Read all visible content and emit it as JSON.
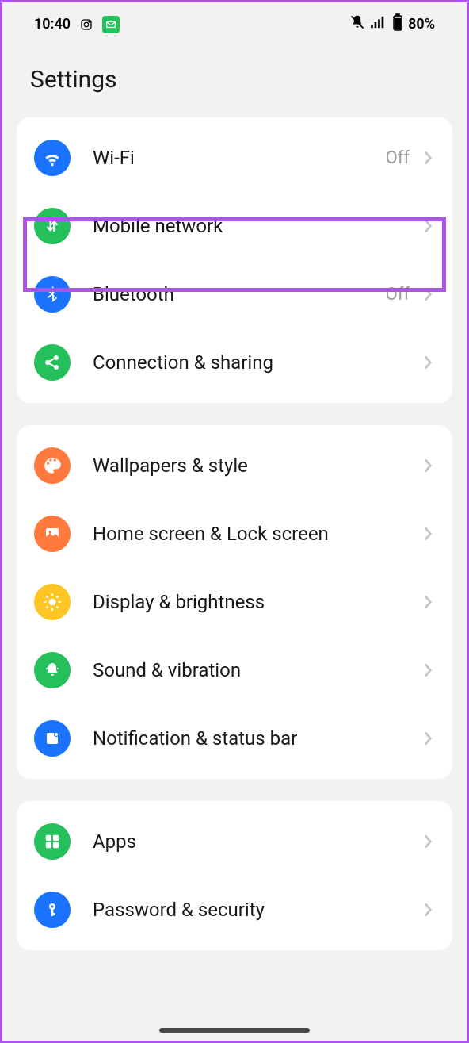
{
  "status": {
    "time": "10:40",
    "battery": "80%"
  },
  "header": {
    "title": "Settings"
  },
  "groups": [
    {
      "items": [
        {
          "key": "wifi",
          "label": "Wi-Fi",
          "status": "Off",
          "icon": "wifi",
          "color": "blue"
        },
        {
          "key": "mobile",
          "label": "Mobile network",
          "status": "",
          "icon": "data",
          "color": "green",
          "highlighted": true
        },
        {
          "key": "bluetooth",
          "label": "Bluetooth",
          "status": "Off",
          "icon": "bluetooth",
          "color": "blue"
        },
        {
          "key": "connection",
          "label": "Connection & sharing",
          "status": "",
          "icon": "share",
          "color": "green"
        }
      ]
    },
    {
      "items": [
        {
          "key": "wallpapers",
          "label": "Wallpapers & style",
          "status": "",
          "icon": "palette",
          "color": "orange"
        },
        {
          "key": "homescreen",
          "label": "Home screen & Lock screen",
          "status": "",
          "icon": "image",
          "color": "orange"
        },
        {
          "key": "display",
          "label": "Display & brightness",
          "status": "",
          "icon": "sun",
          "color": "yellow"
        },
        {
          "key": "sound",
          "label": "Sound & vibration",
          "status": "",
          "icon": "bell",
          "color": "green"
        },
        {
          "key": "notification",
          "label": "Notification & status bar",
          "status": "",
          "icon": "notif",
          "color": "blue"
        }
      ]
    },
    {
      "items": [
        {
          "key": "apps",
          "label": "Apps",
          "status": "",
          "icon": "apps",
          "color": "green"
        },
        {
          "key": "security",
          "label": "Password & security",
          "status": "",
          "icon": "key",
          "color": "blue"
        }
      ]
    }
  ]
}
